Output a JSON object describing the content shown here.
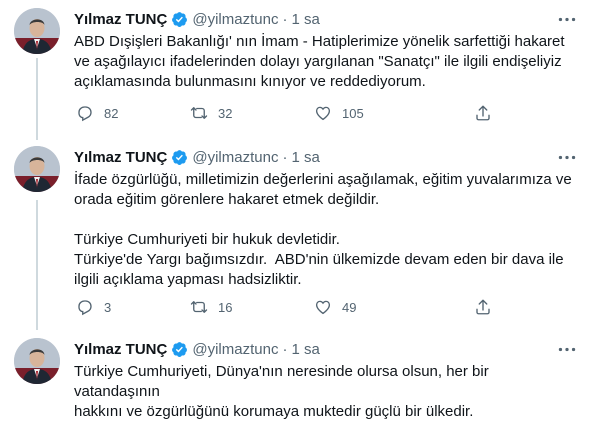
{
  "tweets": [
    {
      "author": "Yılmaz TUNÇ",
      "handle": "@yilmaztunc",
      "separator": "·",
      "time": "1 sa",
      "lines": [
        "ABD Dışişleri Bakanlığı' nın İmam - Hatiplerimize yönelik sarfettiği hakaret",
        "ve aşağılayıcı ifadelerinden dolayı yargılanan \"Sanatçı\" ile ilgili endişeliyiz",
        "açıklamasında bulunmasını kınıyor ve reddediyorum."
      ],
      "replies": "82",
      "retweets": "32",
      "likes": "105"
    },
    {
      "author": "Yılmaz TUNÇ",
      "handle": "@yilmaztunc",
      "separator": "·",
      "time": "1 sa",
      "lines": [
        "İfade özgürlüğü, milletimizin değerlerini aşağılamak, eğitim yuvalarımıza ve",
        "orada eğitim görenlere hakaret etmek değildir.",
        "",
        "Türkiye Cumhuriyeti bir hukuk devletidir.",
        "Türkiye'de Yargı bağımsızdır.  ABD'nin ülkemizde devam eden bir dava ile",
        "ilgili açıklama yapması hadsizliktir."
      ],
      "replies": "3",
      "retweets": "16",
      "likes": "49"
    },
    {
      "author": "Yılmaz TUNÇ",
      "handle": "@yilmaztunc",
      "separator": "·",
      "time": "1 sa",
      "lines": [
        "Türkiye Cumhuriyeti, Dünya'nın neresinde olursa olsun, her bir vatandaşının",
        "hakkını ve özgürlüğünü korumaya muktedir güçlü bir ülkedir."
      ]
    }
  ],
  "icons": {
    "verified": "verified-badge-icon",
    "more": "more-options-icon",
    "reply": "reply-icon",
    "retweet": "retweet-icon",
    "like": "heart-icon",
    "share": "share-icon"
  },
  "colors": {
    "verified": "#1d9bf0",
    "secondary_text": "#536471",
    "thread_line": "#cfd9de"
  }
}
